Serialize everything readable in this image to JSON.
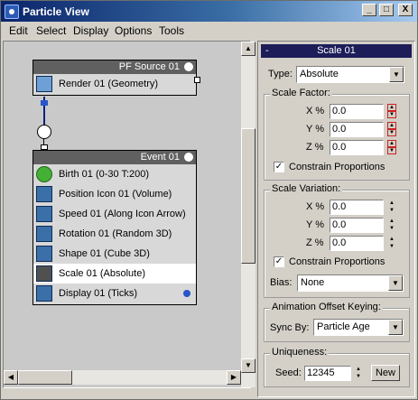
{
  "window": {
    "title": "Particle View",
    "controls": [
      "_",
      "□",
      "X"
    ]
  },
  "menu": [
    "Edit",
    "Select",
    "Display",
    "Options",
    "Tools"
  ],
  "graph": {
    "source_node": {
      "header": "PF Source 01",
      "rows": [
        {
          "label": "Render 01 (Geometry)",
          "icon": "render-icon"
        }
      ]
    },
    "event_node": {
      "header": "Event 01",
      "rows": [
        {
          "label": "Birth 01 (0-30 T:200)",
          "icon": "birth-icon"
        },
        {
          "label": "Position Icon 01 (Volume)",
          "icon": "position-icon"
        },
        {
          "label": "Speed 01 (Along Icon Arrow)",
          "icon": "speed-icon"
        },
        {
          "label": "Rotation 01 (Random 3D)",
          "icon": "rotation-icon"
        },
        {
          "label": "Shape 01 (Cube 3D)",
          "icon": "shape-icon"
        },
        {
          "label": "Scale 01 (Absolute)",
          "icon": "scale-icon",
          "selected": true
        },
        {
          "label": "Display 01 (Ticks)",
          "icon": "display-icon"
        }
      ]
    }
  },
  "rollout": {
    "title": "Scale 01",
    "collapse_symbol": "-",
    "type_label": "Type:",
    "type_value": "Absolute",
    "scale_factor": {
      "legend": "Scale Factor:",
      "x_label": "X %",
      "x_value": "0.0",
      "y_label": "Y %",
      "y_value": "0.0",
      "z_label": "Z %",
      "z_value": "0.0",
      "constrain_label": "Constrain Proportions",
      "constrain_checked": true
    },
    "scale_variation": {
      "legend": "Scale Variation:",
      "x_label": "X %",
      "x_value": "0.0",
      "y_label": "Y %",
      "y_value": "0.0",
      "z_label": "Z %",
      "z_value": "0.0",
      "constrain_label": "Constrain Proportions",
      "constrain_checked": true
    },
    "bias_label": "Bias:",
    "bias_value": "None",
    "animation": {
      "legend": "Animation Offset Keying:",
      "sync_label": "Sync By:",
      "sync_value": "Particle Age"
    },
    "uniqueness": {
      "legend": "Uniqueness:",
      "seed_label": "Seed:",
      "seed_value": "12345",
      "new_button": "New"
    }
  },
  "colors": {
    "title_bar": "#0a246a",
    "node_header": "#606060",
    "rollout_header": "#1d1d5a",
    "connector": "#002080"
  }
}
